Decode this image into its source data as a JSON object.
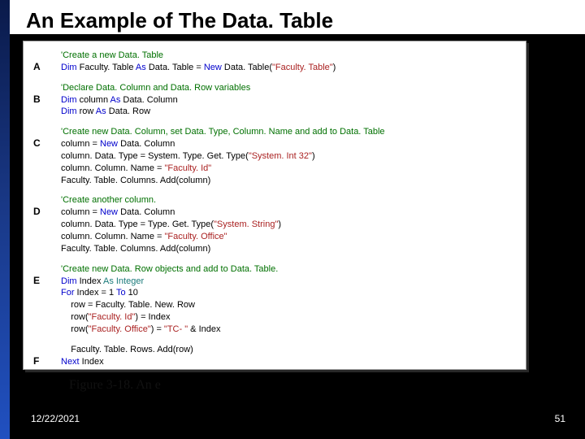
{
  "title": "An Example of The Data. Table",
  "blocks": [
    {
      "label": "A",
      "lines": [
        {
          "segs": [
            {
              "t": "'Create a new Data. Table",
              "c": "comment"
            }
          ]
        },
        {
          "segs": [
            {
              "t": "Dim",
              "c": "keyword"
            },
            {
              "t": " Faculty. Table "
            },
            {
              "t": "As",
              "c": "keyword"
            },
            {
              "t": " Data. Table = "
            },
            {
              "t": "New",
              "c": "keyword"
            },
            {
              "t": " Data. Table("
            },
            {
              "t": "\"Faculty. Table\"",
              "c": "string"
            },
            {
              "t": ")"
            }
          ]
        }
      ]
    },
    {
      "label": "B",
      "lines": [
        {
          "segs": [
            {
              "t": "'Declare Data. Column and Data. Row variables",
              "c": "comment"
            }
          ]
        },
        {
          "segs": [
            {
              "t": "Dim",
              "c": "keyword"
            },
            {
              "t": " column "
            },
            {
              "t": "As",
              "c": "keyword"
            },
            {
              "t": " Data. Column"
            }
          ]
        },
        {
          "segs": [
            {
              "t": "Dim",
              "c": "keyword"
            },
            {
              "t": " row "
            },
            {
              "t": "As",
              "c": "keyword"
            },
            {
              "t": " Data. Row"
            }
          ]
        }
      ]
    },
    {
      "label": "C",
      "lines": [
        {
          "segs": [
            {
              "t": "'Create new Data. Column, set Data. Type, Column. Name and add to Data. Table",
              "c": "comment"
            }
          ]
        },
        {
          "segs": [
            {
              "t": "column = "
            },
            {
              "t": "New",
              "c": "keyword"
            },
            {
              "t": " Data. Column"
            }
          ]
        },
        {
          "segs": [
            {
              "t": "column. Data. Type = System. Type. Get. Type("
            },
            {
              "t": "\"System. Int 32\"",
              "c": "string"
            },
            {
              "t": ")"
            }
          ]
        },
        {
          "segs": [
            {
              "t": "column. Column. Name = "
            },
            {
              "t": "\"Faculty. Id\"",
              "c": "string"
            }
          ]
        },
        {
          "segs": [
            {
              "t": "Faculty. Table. Columns. Add(column)"
            }
          ]
        }
      ]
    },
    {
      "label": "D",
      "lines": [
        {
          "segs": [
            {
              "t": "'Create another column.",
              "c": "comment"
            }
          ]
        },
        {
          "segs": [
            {
              "t": "column = "
            },
            {
              "t": "New",
              "c": "keyword"
            },
            {
              "t": " Data. Column"
            }
          ]
        },
        {
          "segs": [
            {
              "t": "column. Data. Type = Type. Get. Type("
            },
            {
              "t": "\"System. String\"",
              "c": "string"
            },
            {
              "t": ")"
            }
          ]
        },
        {
          "segs": [
            {
              "t": "column. Column. Name = "
            },
            {
              "t": "\"Faculty. Office\"",
              "c": "string"
            }
          ]
        },
        {
          "segs": [
            {
              "t": "Faculty. Table. Columns. Add(column)"
            }
          ]
        }
      ]
    },
    {
      "label": "E",
      "lines": [
        {
          "segs": [
            {
              "t": "'Create new Data. Row objects and add to Data. Table.",
              "c": "comment"
            }
          ]
        },
        {
          "segs": [
            {
              "t": "Dim",
              "c": "keyword"
            },
            {
              "t": " Index "
            },
            {
              "t": "As Integer",
              "c": "typename"
            }
          ]
        },
        {
          "segs": [
            {
              "t": "For",
              "c": "keyword"
            },
            {
              "t": " Index = 1 "
            },
            {
              "t": "To",
              "c": "keyword"
            },
            {
              "t": " 10"
            }
          ]
        },
        {
          "segs": [
            {
              "t": "    row = Faculty. Table. New. Row"
            }
          ]
        },
        {
          "segs": [
            {
              "t": "    row("
            },
            {
              "t": "\"Faculty. Id\"",
              "c": "string"
            },
            {
              "t": ") = Index"
            }
          ]
        },
        {
          "segs": [
            {
              "t": "    row("
            },
            {
              "t": "\"Faculty. Office\"",
              "c": "string"
            },
            {
              "t": ") = "
            },
            {
              "t": "\"TC- \"",
              "c": "string"
            },
            {
              "t": " & Index"
            }
          ]
        }
      ]
    },
    {
      "label": "F",
      "lines": [
        {
          "segs": [
            {
              "t": "    Faculty. Table. Rows. Add(row)"
            }
          ]
        },
        {
          "segs": [
            {
              "t": "Next",
              "c": "keyword"
            },
            {
              "t": " Index"
            }
          ]
        }
      ]
    }
  ],
  "caption": "Figure 3-18. An e",
  "date": "12/22/2021",
  "page": "51"
}
